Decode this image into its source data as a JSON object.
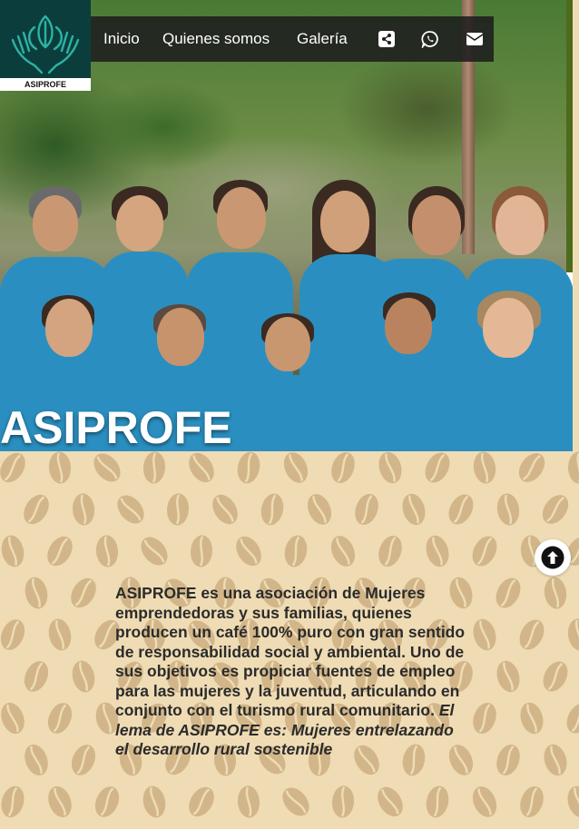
{
  "brand": {
    "logo_text": "ASIPROFE",
    "colors": {
      "logo_bg": "#0c3d3d",
      "logo_line": "#2bb3a3",
      "nav_bg": "#1e1e1e",
      "shirt": "#2a8fc0",
      "beige": "#efdcb4",
      "bean": "#d2b68a"
    }
  },
  "nav": {
    "items": [
      {
        "label": "Inicio"
      },
      {
        "label": "Quienes somos"
      },
      {
        "label": "Galería"
      }
    ],
    "icons": [
      "share-icon",
      "whatsapp-icon",
      "envelope-icon"
    ]
  },
  "hero": {
    "title": "ASIPROFE"
  },
  "intro": {
    "text": "ASIPROFE es una asociación de Mujeres emprendedoras y sus familias, quienes producen un café 100% puro con gran sentido de responsabilidad social y ambiental. Uno de sus objetivos es propiciar fuentes de empleo para las mujeres y la juventud, articulando en conjunto con el turismo rural comunitario.",
    "motto": "El lema de ASIPROFE es: Mujeres entrelazando el desarrollo rural sostenible"
  },
  "scroll_top": {
    "icon": "arrow-up-circle-icon"
  }
}
